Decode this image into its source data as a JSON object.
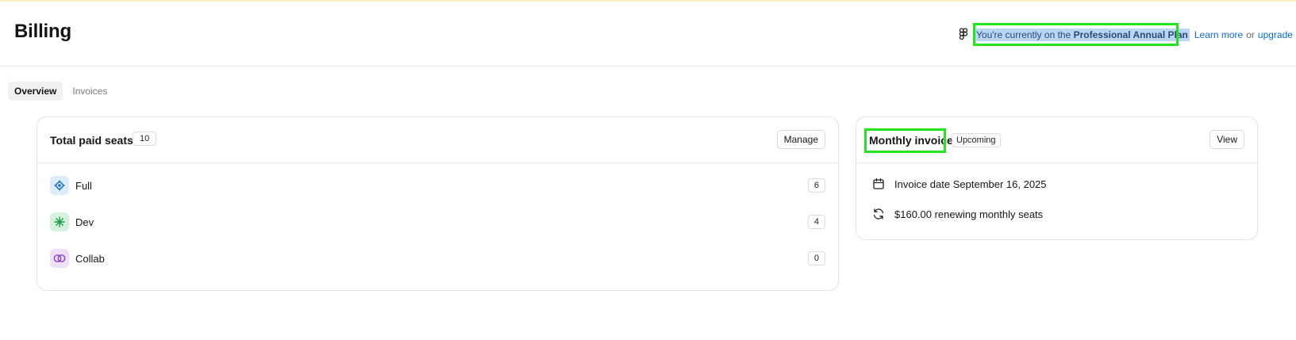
{
  "page": {
    "title": "Billing"
  },
  "plan_notice": {
    "prefix": "You're currently on the ",
    "plan_name": "Professional Annual Plan",
    "learn_more": "Learn more",
    "or": "or",
    "upgrade": "upgrade",
    "highlight_color": "#22e61b"
  },
  "tabs": [
    {
      "label": "Overview",
      "active": true
    },
    {
      "label": "Invoices",
      "active": false
    }
  ],
  "seats_card": {
    "title": "Total paid seats",
    "total": "10",
    "manage_label": "Manage",
    "rows": [
      {
        "label": "Full",
        "count": "6",
        "icon": "full-seat-icon",
        "color": "#1a73c8"
      },
      {
        "label": "Dev",
        "count": "4",
        "icon": "dev-seat-icon",
        "color": "#1e9e4a"
      },
      {
        "label": "Collab",
        "count": "0",
        "icon": "collab-seat-icon",
        "color": "#8a3fc4"
      }
    ]
  },
  "invoice_card": {
    "title": "Monthly invoice",
    "badge": "Upcoming",
    "view_label": "View",
    "invoice_date": "Invoice date September 16, 2025",
    "renewal": "$160.00 renewing monthly seats"
  }
}
